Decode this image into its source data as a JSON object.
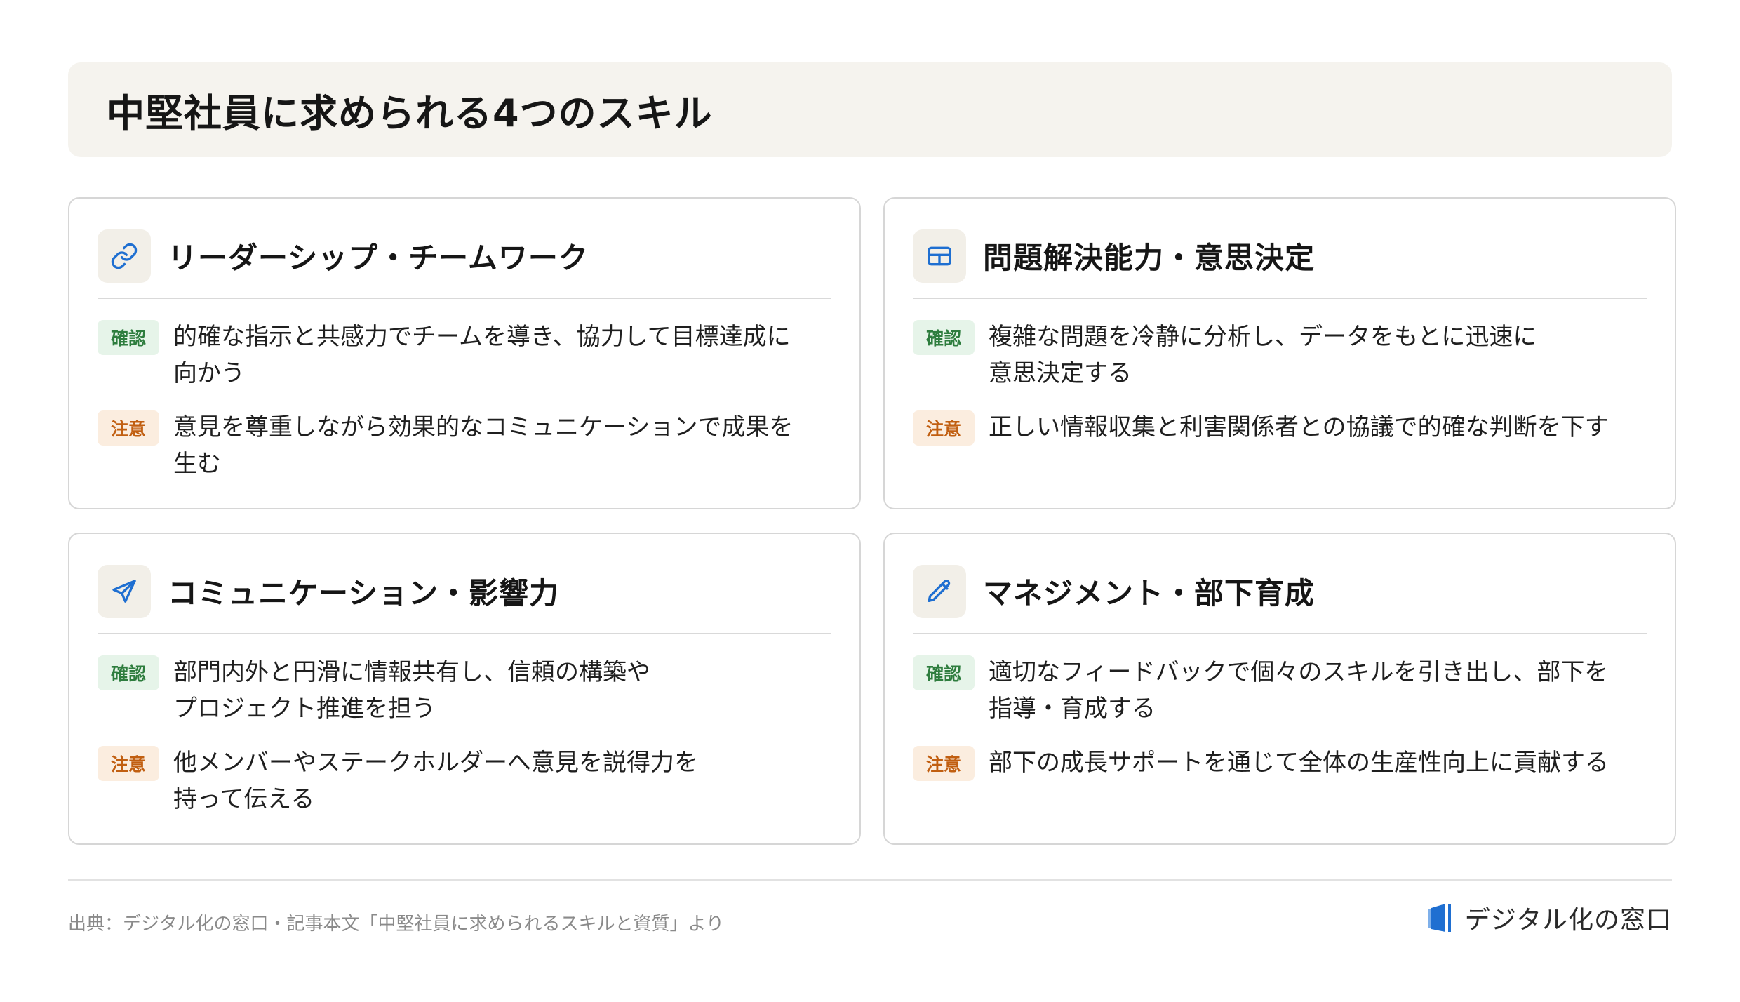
{
  "header": {
    "title": "中堅社員に求められる4つのスキル"
  },
  "cards": [
    {
      "icon": "link-icon",
      "title": "リーダーシップ・チームワーク",
      "confirm_label": "確認",
      "confirm_text": "的確な指示と共感力でチームを導き、協力して目標達成に\n向かう",
      "caution_label": "注意",
      "caution_text": "意見を尊重しながら効果的なコミュニケーションで成果を\n生む"
    },
    {
      "icon": "grid-icon",
      "title": "問題解決能力・意思決定",
      "confirm_label": "確認",
      "confirm_text": "複雑な問題を冷静に分析し、データをもとに迅速に\n意思決定する",
      "caution_label": "注意",
      "caution_text": "正しい情報収集と利害関係者との協議で的確な判断を下す"
    },
    {
      "icon": "send-icon",
      "title": "コミュニケーション・影響力",
      "confirm_label": "確認",
      "confirm_text": "部門内外と円滑に情報共有し、信頼の構築や\nプロジェクト推進を担う",
      "caution_label": "注意",
      "caution_text": "他メンバーやステークホルダーへ意見を説得力を\n持って伝える"
    },
    {
      "icon": "pencil-icon",
      "title": "マネジメント・部下育成",
      "confirm_label": "確認",
      "confirm_text": "適切なフィードバックで個々のスキルを引き出し、部下を\n指導・育成する",
      "caution_label": "注意",
      "caution_text": "部下の成長サポートを通じて全体の生産性向上に貢献する"
    }
  ],
  "footer": {
    "source": "出典：デジタル化の窓口・記事本文「中堅社員に求められるスキルと資質」より",
    "logo_text": "デジタル化の窓口"
  },
  "colors": {
    "accent_blue": "#1f6fd1",
    "confirm_green": "#2e7d3e",
    "caution_orange": "#c15f11"
  }
}
